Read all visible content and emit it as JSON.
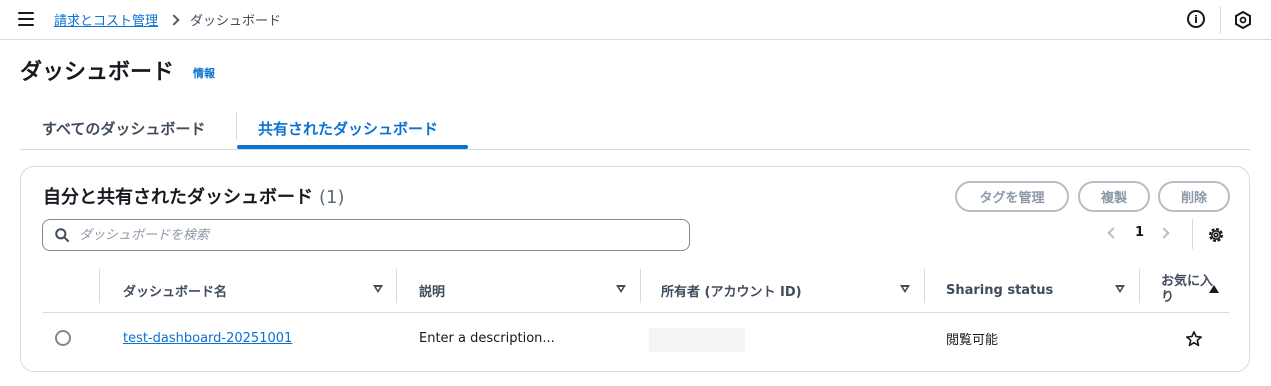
{
  "breadcrumb": {
    "root": "請求とコスト管理",
    "current": "ダッシュボード"
  },
  "header": {
    "title": "ダッシュボード",
    "info_link": "情報"
  },
  "tabs": [
    {
      "label": "すべてのダッシュボード",
      "active": false
    },
    {
      "label": "共有されたダッシュボード",
      "active": true
    }
  ],
  "container": {
    "title": "自分と共有されたダッシュボード",
    "count": "(1)",
    "buttons": {
      "manage_tags": "タグを管理",
      "copy": "複製",
      "delete": "削除"
    },
    "search": {
      "placeholder": "ダッシュボードを検索"
    },
    "pagination": {
      "current_page": "1"
    }
  },
  "table": {
    "columns": [
      "ダッシュボード名",
      "説明",
      "所有者 (アカウント ID)",
      "Sharing status",
      "お気に入り"
    ],
    "rows": [
      {
        "name": "test-dashboard-20251001",
        "description": "Enter a description...",
        "owner": "",
        "sharing_status": "閲覧可能",
        "favorite": false
      }
    ]
  },
  "colors": {
    "accent": "#0972d3",
    "text": "#16191f",
    "border": "#d5dbdb",
    "disabled": "#8d99a8"
  },
  "icons": [
    "menu-icon",
    "chevron-right-icon",
    "info-icon",
    "hexagon-icon",
    "search-icon",
    "chevron-left-icon",
    "gear-icon",
    "sort-icon",
    "star-icon"
  ]
}
